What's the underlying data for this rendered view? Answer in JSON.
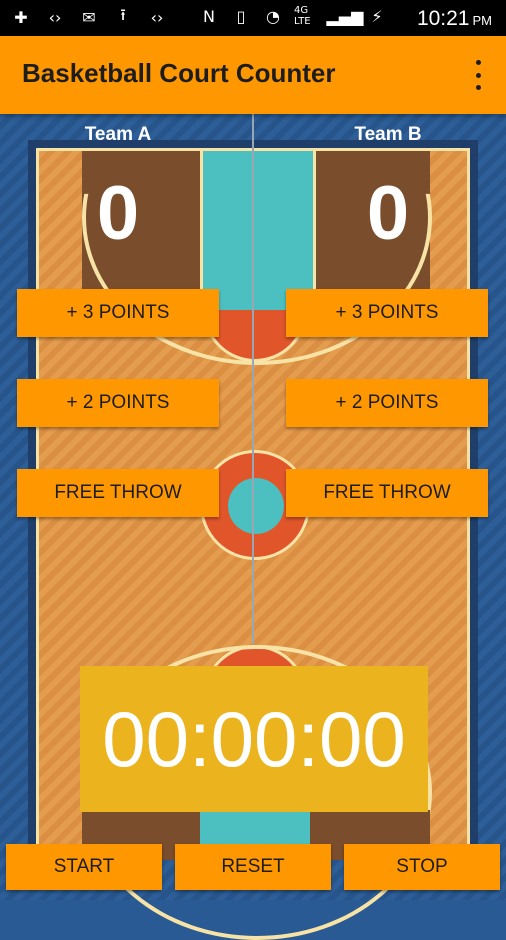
{
  "status_bar": {
    "time": "10:21",
    "ampm": "PM",
    "network": "4G LTE",
    "icons_left": [
      "plus-box-icon",
      "code-icon",
      "mail-icon",
      "usb-icon",
      "code-icon"
    ],
    "icons_right": [
      "nfc-icon",
      "vibrate-icon",
      "wifi-icon",
      "signal-icon",
      "battery-charging-icon"
    ]
  },
  "app_bar": {
    "title": "Basketball Court Counter"
  },
  "team_a": {
    "label": "Team A",
    "score": "0",
    "btn_three": "+ 3 POINTS",
    "btn_two": "+ 2 POINTS",
    "btn_free": "FREE THROW"
  },
  "team_b": {
    "label": "Team B",
    "score": "0",
    "btn_three": "+ 3 POINTS",
    "btn_two": "+ 2 POINTS",
    "btn_free": "FREE THROW"
  },
  "timer": {
    "display": "00:00:00"
  },
  "controls": {
    "start": "START",
    "reset": "RESET",
    "stop": "STOP"
  },
  "colors": {
    "accent": "#ff9800",
    "timer_bg": "#ebb41f",
    "court": "#e49c4f",
    "paint": "#4cc0c0"
  }
}
